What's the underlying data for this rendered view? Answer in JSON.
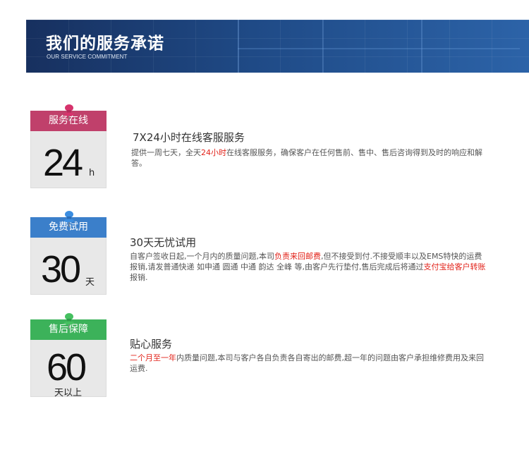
{
  "header": {
    "title": "我们的服务承诺",
    "subtitle": "OUR SERVICE COMMITMENT"
  },
  "colors": {
    "red": "#c0406b",
    "blue": "#3b7fca",
    "green": "#3cb25a",
    "highlight": "#e2231a"
  },
  "items": [
    {
      "badge_label": "服务在线",
      "badge_number": "24",
      "badge_unit": "h",
      "pin_icon": "red-pushpin-icon",
      "title": "7X24小时在线客服服务",
      "desc_1": "提供一周七天，全天",
      "desc_2": "24小时",
      "desc_3": "在线客服服务，确保客户在任何售前、售中、售后咨询得到及时的响应和解答。"
    },
    {
      "badge_label": "免费试用",
      "badge_number": "30",
      "badge_unit": "天",
      "pin_icon": "blue-pushpin-icon",
      "title": "30天无忧试用",
      "desc_1": "自客户签收日起,一个月内的质量问题,本司",
      "desc_2": "负责来回邮费",
      "desc_3": ",但不接受到付.不接受顺丰以及EMS特快的运费报销,请发普通快递 如申通 圆通 中通 韵达 全峰 等,由客户先行垫付,售后完成后将通过",
      "desc_4": "支付宝给客户转账",
      "desc_5": "报销."
    },
    {
      "badge_label": "售后保障",
      "badge_number": "60",
      "badge_unit": "天以上",
      "pin_icon": "green-pushpin-icon",
      "title": "贴心服务",
      "desc_1": "二个月至一年",
      "desc_2": "内质量问题,本司与客户各自负责各自寄出的邮费,超一年的问题由客户承担维修费用及来回运费."
    }
  ]
}
